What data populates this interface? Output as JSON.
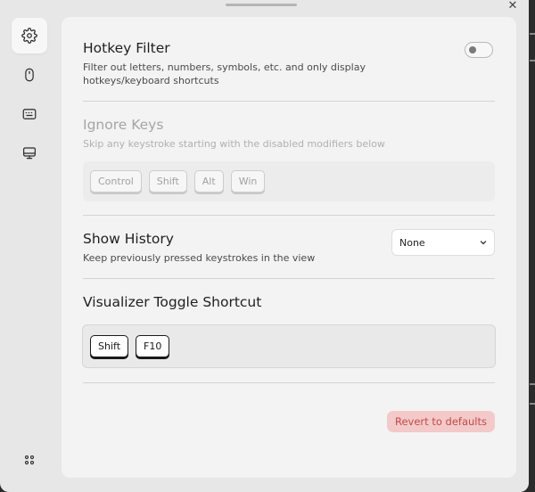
{
  "window": {
    "close_glyph": "✕"
  },
  "sidebar": {
    "items": [
      {
        "name": "settings",
        "icon": "gear-icon",
        "active": true
      },
      {
        "name": "mouse",
        "icon": "mouse-icon",
        "active": false
      },
      {
        "name": "keyboard",
        "icon": "keyboard-icon",
        "active": false
      },
      {
        "name": "display",
        "icon": "monitor-icon",
        "active": false
      }
    ],
    "bottom_icon": "grid-dots-icon"
  },
  "hotkey_filter": {
    "title": "Hotkey Filter",
    "description": "Filter out letters, numbers, symbols, etc. and only display hotkeys/keyboard shortcuts",
    "enabled": false
  },
  "ignore_keys": {
    "title": "Ignore Keys",
    "description": "Skip any keystroke starting with the disabled modifiers below",
    "keys": [
      "Control",
      "Shift",
      "Alt",
      "Win"
    ]
  },
  "show_history": {
    "title": "Show History",
    "description": "Keep previously pressed keystrokes in the view",
    "selected": "None"
  },
  "visualizer_toggle": {
    "title": "Visualizer Toggle Shortcut",
    "keys": [
      "Shift",
      "F10"
    ]
  },
  "footer": {
    "revert_label": "Revert to defaults"
  },
  "colors": {
    "accent_danger_bg": "#f3c9c9",
    "accent_danger_text": "#c24a4a"
  }
}
